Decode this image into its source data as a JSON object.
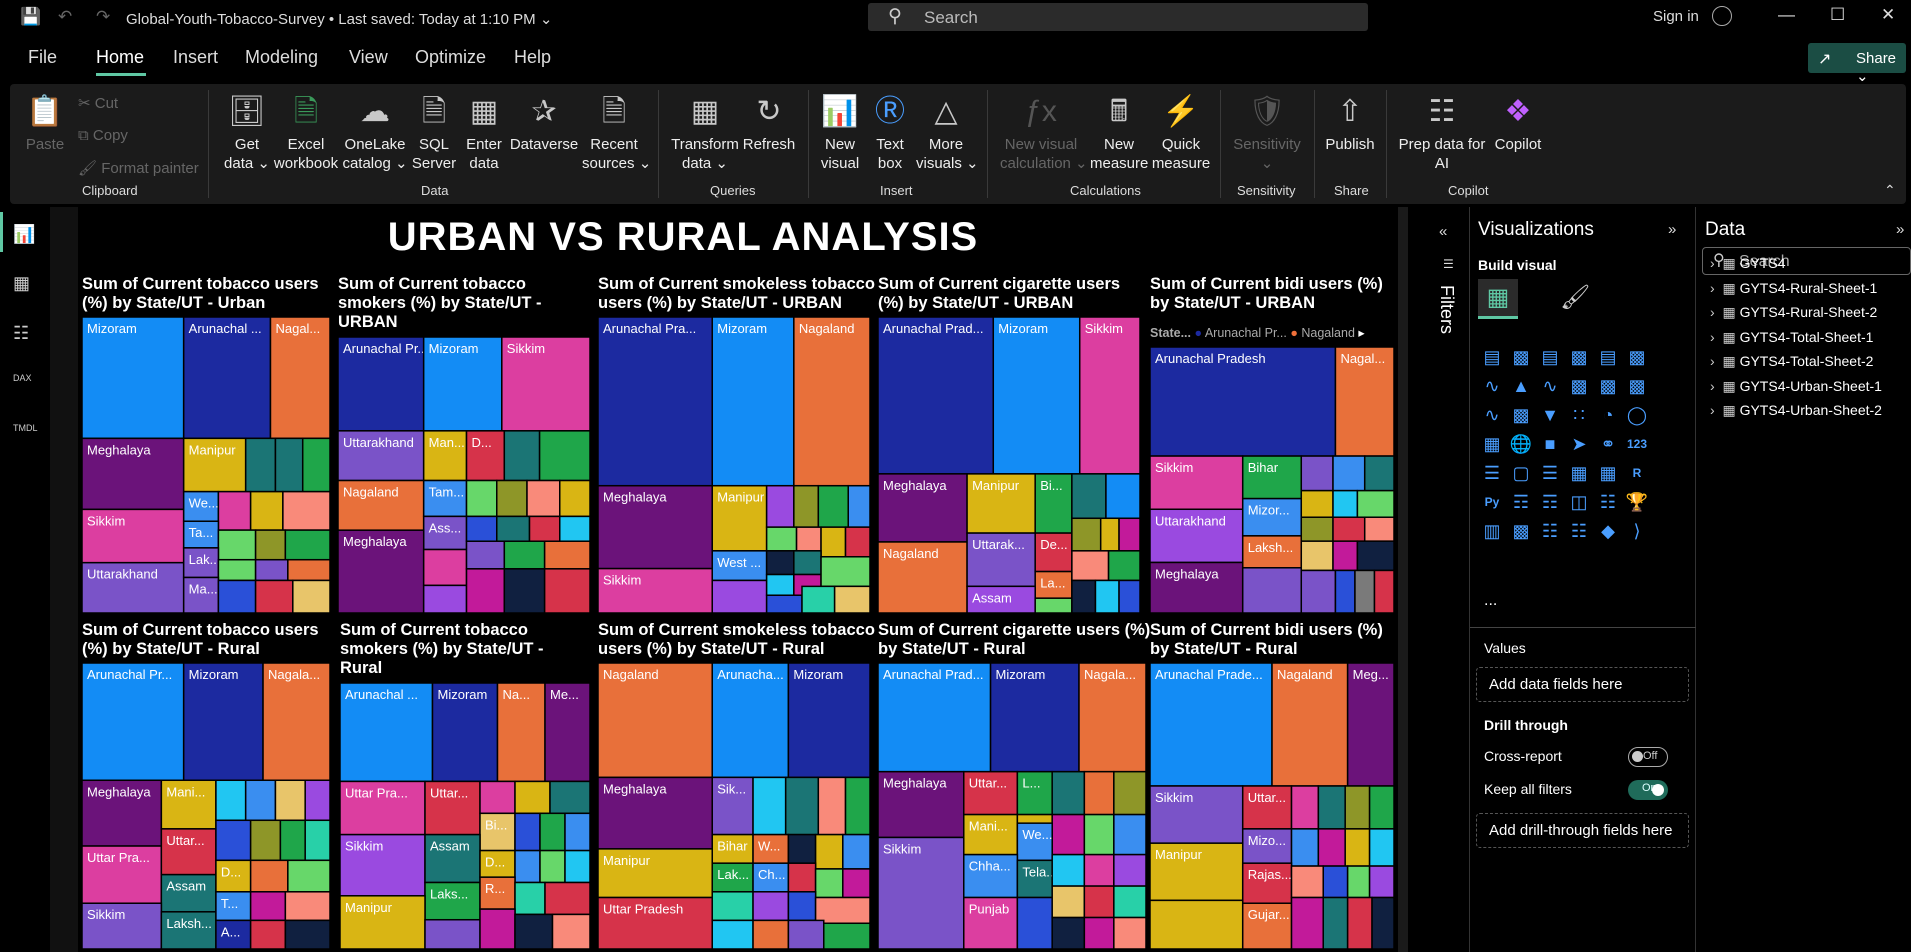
{
  "titlebar": {
    "doc_title": "Global-Youth-Tobacco-Survey  •  Last saved: Today at 1:10 PM  ⌄",
    "search_placeholder": "Search",
    "signin": "Sign in"
  },
  "menu": [
    "File",
    "Home",
    "Insert",
    "Modeling",
    "View",
    "Optimize",
    "Help"
  ],
  "share_label": "Share ⌄",
  "ribbon": {
    "clipboard": {
      "paste": "Paste",
      "cut": "Cut",
      "copy": "Copy",
      "format_painter": "Format painter",
      "group": "Clipboard"
    },
    "data": {
      "buttons": [
        {
          "l1": "Get",
          "l2": "data ⌄"
        },
        {
          "l1": "Excel",
          "l2": "workbook"
        },
        {
          "l1": "OneLake",
          "l2": "catalog ⌄"
        },
        {
          "l1": "SQL",
          "l2": "Server"
        },
        {
          "l1": "Enter",
          "l2": "data"
        },
        {
          "l1": "Dataverse",
          "l2": ""
        },
        {
          "l1": "Recent",
          "l2": "sources ⌄"
        }
      ],
      "group": "Data"
    },
    "queries": {
      "transform_l1": "Transform",
      "transform_l2": "data ⌄",
      "refresh": "Refresh",
      "group": "Queries"
    },
    "insert": {
      "new_visual_l1": "New",
      "new_visual_l2": "visual",
      "text_l1": "Text",
      "text_l2": "box",
      "more_l1": "More",
      "more_l2": "visuals ⌄",
      "group": "Insert"
    },
    "calculations": {
      "newcalc_l1": "New visual",
      "newcalc_l2": "calculation ⌄",
      "newmeasure_l1": "New",
      "newmeasure_l2": "measure",
      "quick_l1": "Quick",
      "quick_l2": "measure",
      "group": "Calculations"
    },
    "sensitivity": {
      "l1": "Sensitivity",
      "l2": "⌄",
      "group": "Sensitivity"
    },
    "share": {
      "publish": "Publish",
      "group": "Share"
    },
    "copilot": {
      "prep_l1": "Prep data for",
      "prep_l2": "AI",
      "copilot": "Copilot",
      "group": "Copilot"
    }
  },
  "report": {
    "title": "URBAN VS RURAL ANALYSIS",
    "tiles": [
      {
        "title": "Sum of Current tobacco users (%) by State/UT - Urban"
      },
      {
        "title": "Sum of Current tobacco smokers (%) by State/UT - URBAN"
      },
      {
        "title": "Sum of Current smokeless tobacco users (%) by State/UT - URBAN"
      },
      {
        "title": "Sum of Current cigarette users (%) by State/UT - URBAN"
      },
      {
        "title": "Sum of Current bidi users (%) by State/UT - URBAN"
      },
      {
        "title": "Sum of Current tobacco users (%) by State/UT - Rural"
      },
      {
        "title": "Sum of Current tobacco smokers (%) by State/UT - Rural"
      },
      {
        "title": "Sum of Current smokeless tobacco users (%) by State/UT - Rural"
      },
      {
        "title": "Sum of Current cigarette users (%) by State/UT - Rural"
      },
      {
        "title": "Sum of Current bidi users (%) by State/UT - Rural"
      }
    ],
    "legend5": {
      "label": "State...",
      "items": [
        "Arunachal Pr...",
        "Nagaland"
      ],
      "colors": [
        "#1c2aa0",
        "#f0703a"
      ]
    }
  },
  "chart_data": [
    {
      "type": "treemap",
      "title": "Sum of Current tobacco users (%) by State/UT - Urban",
      "labels": [
        "Mizoram",
        "Arunachal ...",
        "Nagal...",
        "Meghalaya",
        "Manipur",
        "Sikkim",
        "We...",
        "Ta...",
        "Uttarakhand",
        "Lak...",
        "Ma..."
      ]
    },
    {
      "type": "treemap",
      "title": "Sum of Current tobacco smokers (%) by State/UT - URBAN",
      "labels": [
        "Arunachal Pr...",
        "Mizoram",
        "Sikkim",
        "Uttarakhand",
        "Man...",
        "D...",
        "Nagaland",
        "Tam...",
        "Ass...",
        "Meghalaya"
      ]
    },
    {
      "type": "treemap",
      "title": "Sum of Current smokeless tobacco users (%) by State/UT - URBAN",
      "labels": [
        "Arunachal Pra...",
        "Mizoram",
        "Nagaland",
        "Meghalaya",
        "Manipur",
        "West ...",
        "Sikkim"
      ]
    },
    {
      "type": "treemap",
      "title": "Sum of Current cigarette users (%) by State/UT - URBAN",
      "labels": [
        "Arunachal Prad...",
        "Mizoram",
        "Sikkim",
        "Meghalaya",
        "Manipur",
        "Bi...",
        "De...",
        "Uttarak...",
        "La...",
        "Nagaland",
        "Assam"
      ]
    },
    {
      "type": "treemap",
      "title": "Sum of Current bidi users (%) by State/UT - URBAN",
      "labels": [
        "Arunachal Pradesh",
        "Nagal...",
        "Sikkim",
        "Bihar",
        "Uttarakhand",
        "Mizor...",
        "Laksh...",
        "Meghalaya"
      ]
    },
    {
      "type": "treemap",
      "title": "Sum of Current tobacco users (%) by State/UT - Rural",
      "labels": [
        "Arunachal Pr...",
        "Mizoram",
        "Nagala...",
        "Meghalaya",
        "Mani...",
        "Uttar Pra...",
        "Uttar...",
        "D...",
        "Sikkim",
        "Assam",
        "T...",
        "Laksh...",
        "A..."
      ]
    },
    {
      "type": "treemap",
      "title": "Sum of Current tobacco smokers (%) by State/UT - Rural",
      "labels": [
        "Arunachal ...",
        "Mizoram",
        "Na...",
        "Me...",
        "Uttar Pra...",
        "Uttar...",
        "Bi...",
        "Sikkim",
        "Assam",
        "D...",
        "Laks...",
        "R...",
        "Manipur"
      ]
    },
    {
      "type": "treemap",
      "title": "Sum of Current smokeless tobacco users (%) by State/UT - Rural",
      "labels": [
        "Nagaland",
        "Arunacha...",
        "Mizoram",
        "Meghalaya",
        "Sik...",
        "Bihar",
        "W...",
        "Lak...",
        "Ch...",
        "Manipur",
        "Uttar Pradesh"
      ]
    },
    {
      "type": "treemap",
      "title": "Sum of Current cigarette users (%) by State/UT - Rural",
      "labels": [
        "Arunachal Prad...",
        "Mizoram",
        "Nagala...",
        "Meghalaya",
        "Uttar...",
        "L...",
        "Mani...",
        "We...",
        "Chha...",
        "Tela...",
        "Sikkim",
        "Punjab"
      ]
    },
    {
      "type": "treemap",
      "title": "Sum of Current bidi users (%) by State/UT - Rural",
      "labels": [
        "Arunachal Prade...",
        "Nagaland",
        "Meg...",
        "Sikkim",
        "Uttar...",
        "Mizo...",
        "Manipur",
        "Rajas...",
        "Gujar..."
      ]
    }
  ],
  "filters_label": "Filters",
  "viz_pane": {
    "title": "Visualizations",
    "build": "Build visual",
    "values": "Values",
    "add_data": "Add data fields here",
    "drill": "Drill through",
    "cross_report": "Cross-report",
    "cross_state": "Off",
    "keep_filters": "Keep all filters",
    "keep_state": "On",
    "add_drill": "Add drill-through fields here",
    "more": "..."
  },
  "data_pane": {
    "title": "Data",
    "search_placeholder": "Search",
    "tables": [
      "GYTS4",
      "GYTS4-Rural-Sheet-1",
      "GYTS4-Rural-Sheet-2",
      "GYTS4-Total-Sheet-1",
      "GYTS4-Total-Sheet-2",
      "GYTS4-Urban-Sheet-1",
      "GYTS4-Urban-Sheet-2"
    ]
  }
}
